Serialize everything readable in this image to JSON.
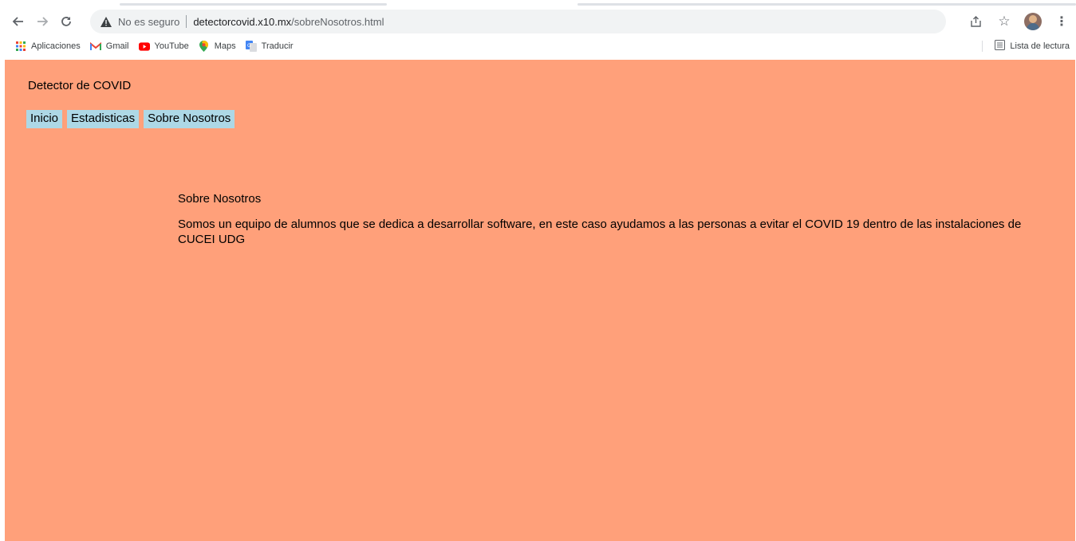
{
  "browser": {
    "nav": {
      "back_icon": "arrow-left-icon",
      "forward_icon": "arrow-right-icon",
      "reload_icon": "reload-icon"
    },
    "omnibox": {
      "security_label": "No es seguro",
      "url_host": "detectorcovid.x10.mx",
      "url_path": "/sobreNosotros.html"
    },
    "bookmarks": [
      {
        "label": "Aplicaciones",
        "icon": "apps-grid-icon"
      },
      {
        "label": "Gmail",
        "icon": "gmail-icon"
      },
      {
        "label": "YouTube",
        "icon": "youtube-icon"
      },
      {
        "label": "Maps",
        "icon": "maps-pin-icon"
      },
      {
        "label": "Traducir",
        "icon": "translate-icon"
      }
    ],
    "reading_list_label": "Lista de lectura"
  },
  "page": {
    "background_color": "#ffa07a",
    "menu_color": "#add8e6",
    "site_title": "Detector de COVID",
    "menu": [
      "Inicio",
      "Estadisticas",
      "Sobre Nosotros"
    ],
    "about_title": "Sobre Nosotros",
    "about_text": "Somos un equipo de alumnos que se dedica a desarrollar software, en este caso ayudamos a las personas a evitar el COVID 19 dentro de las instalaciones de CUCEI UDG"
  }
}
